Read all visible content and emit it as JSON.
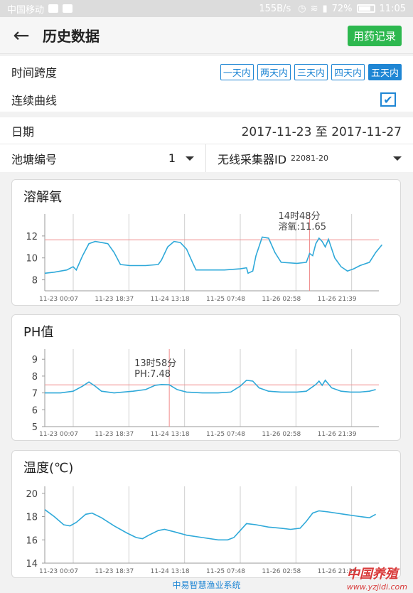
{
  "status_bar": {
    "carrier": "中国移动",
    "speed": "155B/s",
    "battery": "72%",
    "time": "11:05"
  },
  "header": {
    "title": "历史数据",
    "medication_button": "用药记录"
  },
  "time_span": {
    "label": "时间跨度",
    "options": [
      "一天内",
      "两天内",
      "三天内",
      "四天内",
      "五天内"
    ],
    "selected_index": 4
  },
  "continuous_curve": {
    "label": "连续曲线",
    "checked": true
  },
  "date_row": {
    "label": "日期",
    "value": "2017-11-23 至 2017-11-27"
  },
  "pond": {
    "label": "池塘编号",
    "value": "1",
    "collector_label": "无线采集器ID",
    "collector_value": "22081-20"
  },
  "footer": {
    "system_name": "中易智慧渔业系统"
  },
  "watermark": {
    "text": "中国养殖",
    "url": "www.yzjidi.com"
  },
  "colors": {
    "accent": "#1f86d4",
    "green_button": "#2db84f",
    "line": "#2fa9d9",
    "marker": "#f08c8c"
  },
  "chart_data": [
    {
      "type": "line",
      "title": "溶解氧",
      "x_tick_labels": [
        "11-23 00:07",
        "11-23 18:37",
        "11-24 13:18",
        "11-25 07:48",
        "11-26 02:58",
        "11-26 21:39"
      ],
      "y_ticks": [
        8,
        10,
        12
      ],
      "ylim": [
        7,
        14
      ],
      "reference_line": 11.65,
      "marker_x": 0.84,
      "tooltip": [
        "14时48分",
        "溶氧:11.65"
      ],
      "series": [
        {
          "values": [
            [
              0,
              8.6
            ],
            [
              0.03,
              8.7
            ],
            [
              0.07,
              8.9
            ],
            [
              0.09,
              9.2
            ],
            [
              0.1,
              8.9
            ],
            [
              0.12,
              10.2
            ],
            [
              0.14,
              11.3
            ],
            [
              0.16,
              11.5
            ],
            [
              0.18,
              11.4
            ],
            [
              0.2,
              11.3
            ],
            [
              0.22,
              10.5
            ],
            [
              0.24,
              9.4
            ],
            [
              0.27,
              9.3
            ],
            [
              0.32,
              9.3
            ],
            [
              0.36,
              9.4
            ],
            [
              0.37,
              9.8
            ],
            [
              0.39,
              11.0
            ],
            [
              0.41,
              11.5
            ],
            [
              0.43,
              11.4
            ],
            [
              0.45,
              10.8
            ],
            [
              0.47,
              9.5
            ],
            [
              0.48,
              8.9
            ],
            [
              0.52,
              8.9
            ],
            [
              0.57,
              8.9
            ],
            [
              0.62,
              9.0
            ],
            [
              0.64,
              9.1
            ],
            [
              0.645,
              8.6
            ],
            [
              0.66,
              8.8
            ],
            [
              0.67,
              10.2
            ],
            [
              0.69,
              11.9
            ],
            [
              0.71,
              11.8
            ],
            [
              0.73,
              10.5
            ],
            [
              0.75,
              9.6
            ],
            [
              0.8,
              9.5
            ],
            [
              0.83,
              9.6
            ],
            [
              0.84,
              10.4
            ],
            [
              0.85,
              10.2
            ],
            [
              0.86,
              11.3
            ],
            [
              0.87,
              11.8
            ],
            [
              0.88,
              11.5
            ],
            [
              0.89,
              11.0
            ],
            [
              0.9,
              11.7
            ],
            [
              0.92,
              10.0
            ],
            [
              0.94,
              9.2
            ],
            [
              0.96,
              8.8
            ],
            [
              0.98,
              9.0
            ],
            [
              1.0,
              9.3
            ],
            [
              1.03,
              9.6
            ],
            [
              1.05,
              10.5
            ],
            [
              1.07,
              11.2
            ]
          ]
        }
      ]
    },
    {
      "type": "line",
      "title": "PH值",
      "x_tick_labels": [
        "11-23 00:07",
        "11-23 18:37",
        "11-24 13:18",
        "11-25 07:48",
        "11-26 02:58",
        "11-26 21:39"
      ],
      "y_ticks": [
        5,
        6,
        7,
        8,
        9
      ],
      "ylim": [
        5,
        9.6
      ],
      "reference_line": 7.48,
      "marker_x": 0.395,
      "tooltip": [
        "13时58分",
        "PH:7.48"
      ],
      "series": [
        {
          "values": [
            [
              0,
              7.0
            ],
            [
              0.05,
              7.0
            ],
            [
              0.09,
              7.1
            ],
            [
              0.12,
              7.4
            ],
            [
              0.14,
              7.65
            ],
            [
              0.16,
              7.4
            ],
            [
              0.18,
              7.1
            ],
            [
              0.22,
              7.0
            ],
            [
              0.28,
              7.1
            ],
            [
              0.32,
              7.2
            ],
            [
              0.35,
              7.45
            ],
            [
              0.37,
              7.5
            ],
            [
              0.395,
              7.48
            ],
            [
              0.42,
              7.2
            ],
            [
              0.45,
              7.05
            ],
            [
              0.5,
              7.0
            ],
            [
              0.55,
              7.0
            ],
            [
              0.59,
              7.05
            ],
            [
              0.62,
              7.4
            ],
            [
              0.64,
              7.75
            ],
            [
              0.66,
              7.7
            ],
            [
              0.68,
              7.3
            ],
            [
              0.71,
              7.1
            ],
            [
              0.75,
              7.05
            ],
            [
              0.8,
              7.05
            ],
            [
              0.83,
              7.1
            ],
            [
              0.86,
              7.5
            ],
            [
              0.87,
              7.7
            ],
            [
              0.88,
              7.45
            ],
            [
              0.89,
              7.75
            ],
            [
              0.91,
              7.3
            ],
            [
              0.94,
              7.1
            ],
            [
              0.97,
              7.05
            ],
            [
              1.0,
              7.05
            ],
            [
              1.03,
              7.1
            ],
            [
              1.05,
              7.2
            ]
          ]
        }
      ]
    },
    {
      "type": "line",
      "title": "温度(℃)",
      "x_tick_labels": [
        "11-23 00:07",
        "11-23 18:37",
        "11-24 13:18",
        "11-25 07:48",
        "11-26 02:58",
        "11-26 21:39"
      ],
      "y_ticks": [
        14,
        16,
        18,
        20
      ],
      "ylim": [
        14,
        20.6
      ],
      "series": [
        {
          "values": [
            [
              0,
              18.6
            ],
            [
              0.03,
              18.0
            ],
            [
              0.06,
              17.3
            ],
            [
              0.08,
              17.2
            ],
            [
              0.1,
              17.5
            ],
            [
              0.13,
              18.2
            ],
            [
              0.15,
              18.3
            ],
            [
              0.18,
              17.9
            ],
            [
              0.22,
              17.2
            ],
            [
              0.26,
              16.6
            ],
            [
              0.29,
              16.2
            ],
            [
              0.31,
              16.1
            ],
            [
              0.33,
              16.4
            ],
            [
              0.36,
              16.8
            ],
            [
              0.38,
              16.9
            ],
            [
              0.41,
              16.7
            ],
            [
              0.45,
              16.4
            ],
            [
              0.5,
              16.2
            ],
            [
              0.55,
              16.0
            ],
            [
              0.58,
              16.0
            ],
            [
              0.6,
              16.2
            ],
            [
              0.62,
              16.8
            ],
            [
              0.64,
              17.4
            ],
            [
              0.67,
              17.3
            ],
            [
              0.71,
              17.1
            ],
            [
              0.75,
              17.0
            ],
            [
              0.78,
              16.9
            ],
            [
              0.81,
              17.0
            ],
            [
              0.83,
              17.6
            ],
            [
              0.85,
              18.3
            ],
            [
              0.87,
              18.5
            ],
            [
              0.9,
              18.4
            ],
            [
              0.95,
              18.2
            ],
            [
              1.0,
              18.0
            ],
            [
              1.03,
              17.9
            ],
            [
              1.05,
              18.2
            ]
          ]
        }
      ]
    }
  ]
}
